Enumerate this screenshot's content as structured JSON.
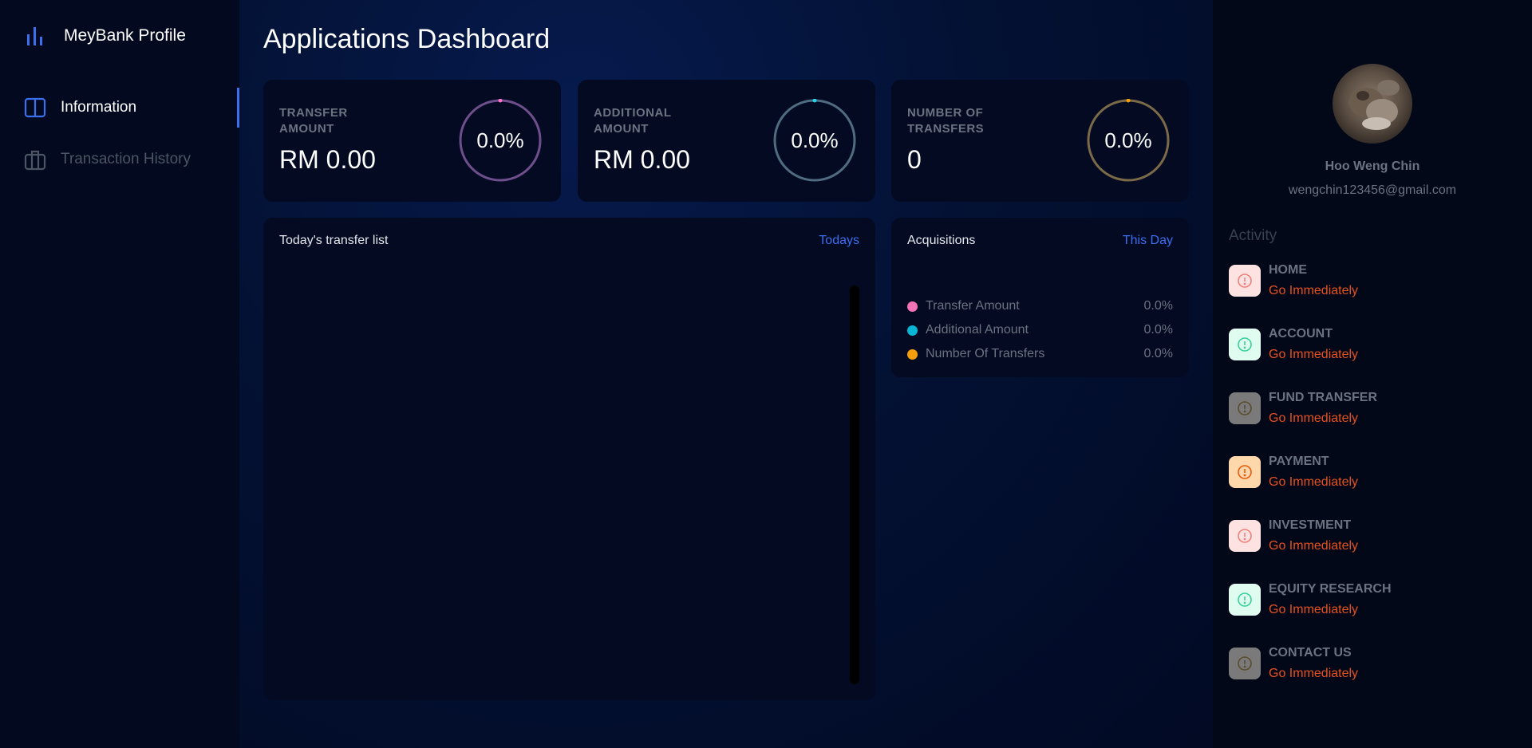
{
  "sidebar": {
    "brand_title": "MeyBank Profile",
    "brand_icon": "bar-chart-icon",
    "items": [
      {
        "label": "Information",
        "icon": "book-open-icon",
        "active": true
      },
      {
        "label": "Transaction History",
        "icon": "briefcase-icon",
        "active": false
      }
    ]
  },
  "main": {
    "title": "Applications Dashboard",
    "stats": [
      {
        "label": "TRANSFER AMOUNT",
        "value": "RM 0.00",
        "percent": "0.0%",
        "ring_color": "#6e4f8c",
        "dot_color": "#ff6ec7"
      },
      {
        "label": "ADDITIONAL AMOUNT",
        "value": "RM 0.00",
        "percent": "0.0%",
        "ring_color": "#4f6c80",
        "dot_color": "#22d3ee"
      },
      {
        "label": "NUMBER OF TRANSFERS",
        "value": "0",
        "percent": "0.0%",
        "ring_color": "#7a6a48",
        "dot_color": "#f59e0b"
      }
    ],
    "transfer_list": {
      "title": "Today's transfer list",
      "link": "Todays"
    },
    "acquisitions": {
      "title": "Acquisitions",
      "link": "This Day",
      "rows": [
        {
          "name": "Transfer Amount",
          "value": "0.0%",
          "color": "#f472b6"
        },
        {
          "name": "Additional Amount",
          "value": "0.0%",
          "color": "#06b6d4"
        },
        {
          "name": "Number Of Transfers",
          "value": "0.0%",
          "color": "#f59e0b"
        }
      ]
    }
  },
  "profile": {
    "name": "Hoo Weng Chin",
    "email": "wengchin123456@gmail.com",
    "activity_title": "Activity",
    "activities": [
      {
        "name": "HOME",
        "link": "Go Immediately",
        "bg": "#fde2e2",
        "fg": "#f08080"
      },
      {
        "name": "ACCOUNT",
        "link": "Go Immediately",
        "bg": "#e0fbef",
        "fg": "#34d399"
      },
      {
        "name": "FUND TRANSFER",
        "link": "Go Immediately",
        "bg": "#7a7a7a",
        "fg": "#5b4a2e"
      },
      {
        "name": "PAYMENT",
        "link": "Go Immediately",
        "bg": "#fed7aa",
        "fg": "#ea580c"
      },
      {
        "name": "INVESTMENT",
        "link": "Go Immediately",
        "bg": "#fde2e2",
        "fg": "#f08080"
      },
      {
        "name": "EQUITY RESEARCH",
        "link": "Go Immediately",
        "bg": "#e0fbef",
        "fg": "#34d399"
      },
      {
        "name": "CONTACT US",
        "link": "Go Immediately",
        "bg": "#7a7a7a",
        "fg": "#5b4a2e"
      }
    ]
  }
}
